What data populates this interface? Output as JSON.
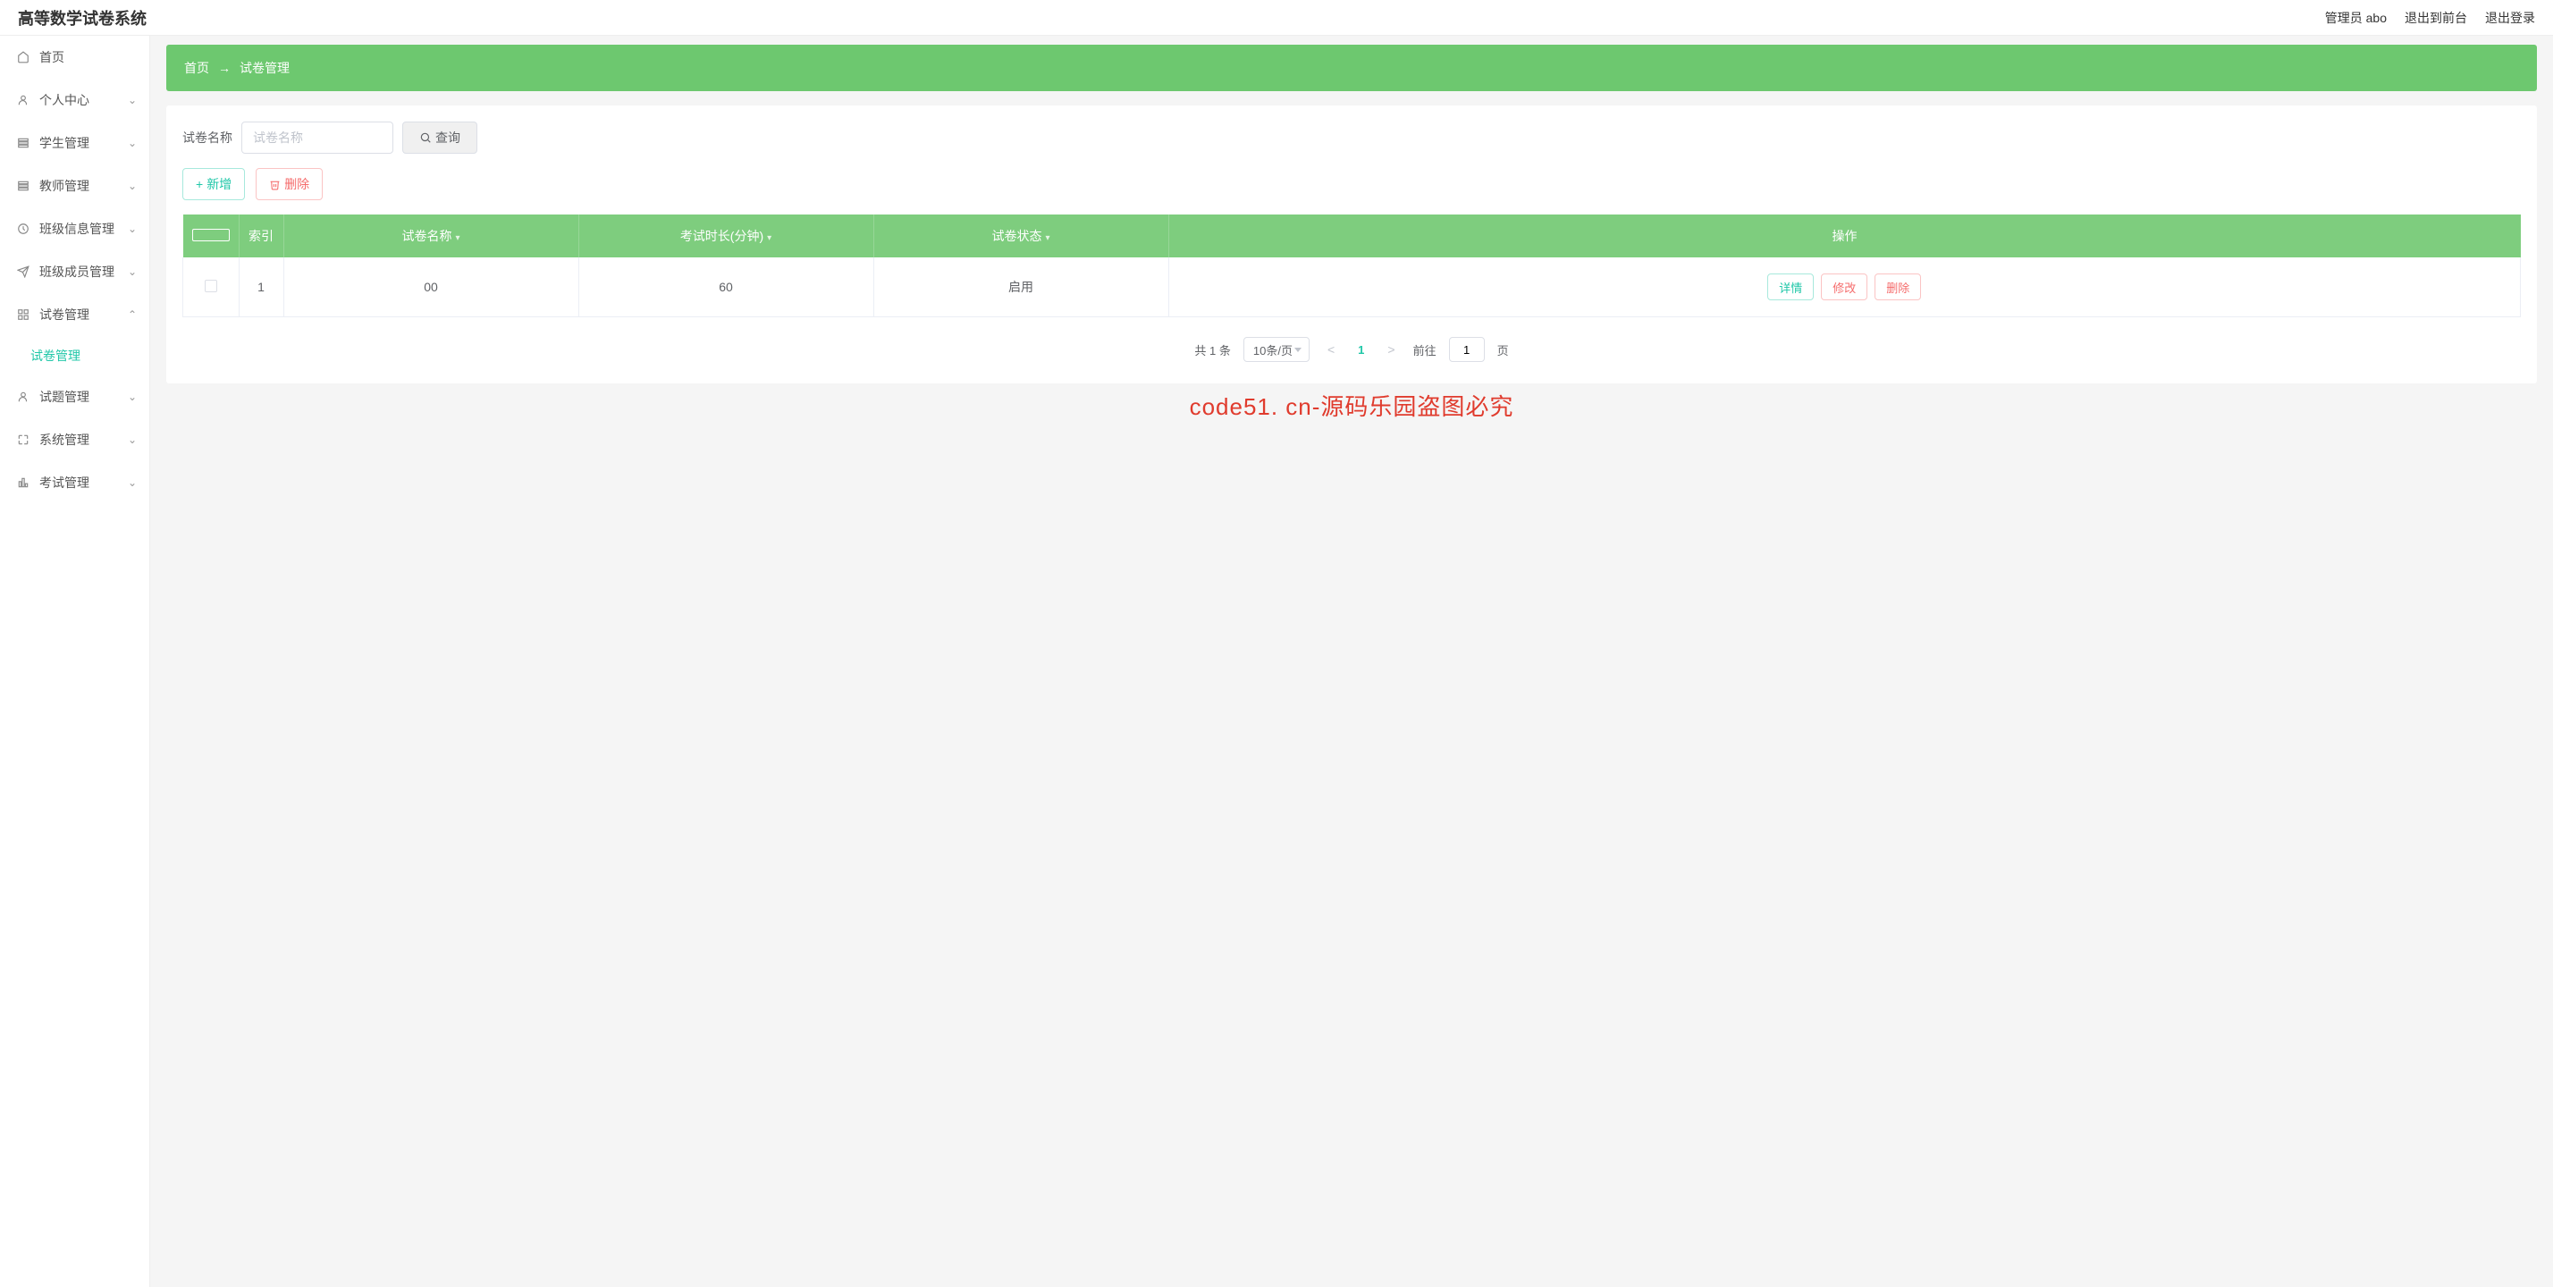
{
  "header": {
    "title": "高等数学试卷系统",
    "admin_label": "管理员 abo",
    "exit_front": "退出到前台",
    "logout": "退出登录"
  },
  "sidebar": {
    "items": [
      {
        "label": "首页",
        "icon": "home-icon",
        "expandable": false
      },
      {
        "label": "个人中心",
        "icon": "user-icon",
        "expandable": true,
        "open": false
      },
      {
        "label": "学生管理",
        "icon": "list-icon",
        "expandable": true,
        "open": false
      },
      {
        "label": "教师管理",
        "icon": "list-icon",
        "expandable": true,
        "open": false
      },
      {
        "label": "班级信息管理",
        "icon": "clock-icon",
        "expandable": true,
        "open": false
      },
      {
        "label": "班级成员管理",
        "icon": "send-icon",
        "expandable": true,
        "open": false
      },
      {
        "label": "试卷管理",
        "icon": "grid-icon",
        "expandable": true,
        "open": true,
        "children": [
          {
            "label": "试卷管理",
            "active": true
          }
        ]
      },
      {
        "label": "试题管理",
        "icon": "user-icon",
        "expandable": true,
        "open": false
      },
      {
        "label": "系统管理",
        "icon": "expand-icon",
        "expandable": true,
        "open": false
      },
      {
        "label": "考试管理",
        "icon": "bar-icon",
        "expandable": true,
        "open": false
      }
    ]
  },
  "breadcrumb": {
    "root": "首页",
    "current": "试卷管理"
  },
  "filter": {
    "label": "试卷名称",
    "placeholder": "试卷名称",
    "search_label": "查询"
  },
  "actions": {
    "add": "新增",
    "delete": "删除"
  },
  "table": {
    "columns": {
      "index": "索引",
      "name": "试卷名称",
      "duration": "考试时长(分钟)",
      "status": "试卷状态",
      "ops": "操作"
    },
    "rows": [
      {
        "index": "1",
        "name": "00",
        "duration": "60",
        "status": "启用"
      }
    ],
    "row_buttons": {
      "detail": "详情",
      "edit": "修改",
      "delete": "删除"
    }
  },
  "pagination": {
    "total_text": "共 1 条",
    "page_size_label": "10条/页",
    "current_page": "1",
    "jump_prefix": "前往",
    "jump_value": "1",
    "jump_suffix": "页"
  },
  "watermark": "code51. cn-源码乐园盗图必究"
}
